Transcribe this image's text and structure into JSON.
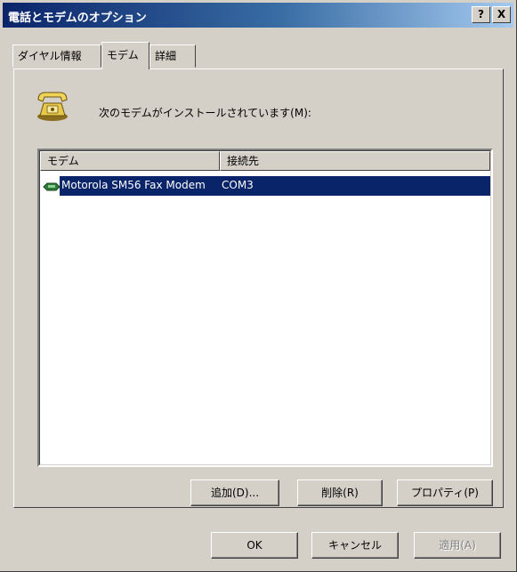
{
  "window": {
    "title": "電話とモデムのオプション",
    "help_button": "?",
    "close_button": "X"
  },
  "tabs": [
    {
      "label": "ダイヤル情報",
      "active": false
    },
    {
      "label": "モデム",
      "active": true
    },
    {
      "label": "詳細",
      "active": false
    }
  ],
  "panel": {
    "icon": "telephone-icon",
    "description": "次のモデムがインストールされています(M):"
  },
  "modem_list": {
    "columns": [
      "モデム",
      "接続先"
    ],
    "rows": [
      {
        "icon": "modem-icon",
        "name": "Motorola SM56 Fax Modem",
        "port": "COM3",
        "selected": true
      }
    ]
  },
  "panel_buttons": {
    "add": "追加(D)...",
    "remove": "削除(R)",
    "properties": "プロパティ(P)"
  },
  "dialog_buttons": {
    "ok": "OK",
    "cancel": "キャンセル",
    "apply": "適用(A)"
  },
  "colors": {
    "selection": "#0a246a",
    "face": "#d4d0c8",
    "title_start": "#0a246a",
    "title_end": "#a6caf0"
  }
}
